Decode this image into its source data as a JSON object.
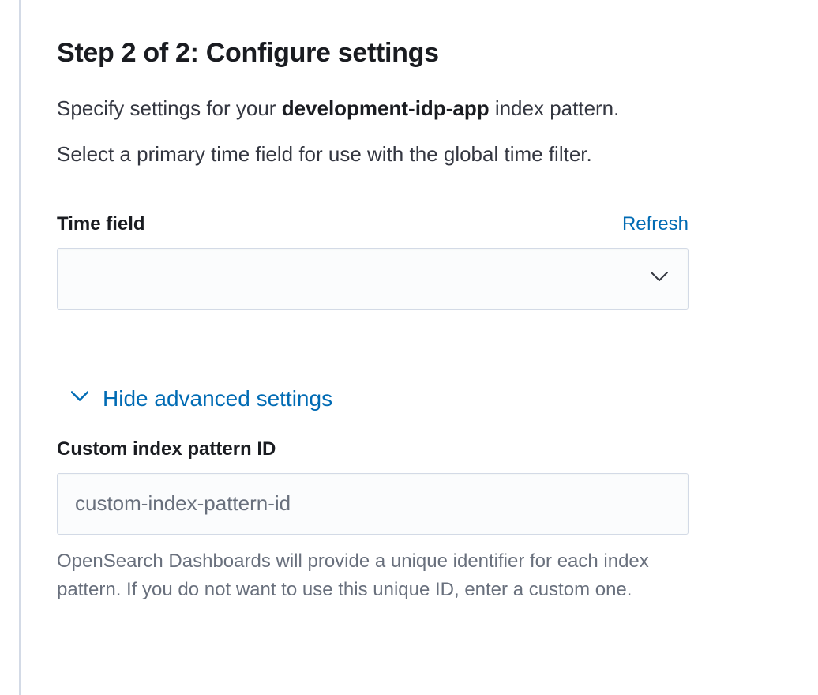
{
  "heading": "Step 2 of 2: Configure settings",
  "description_prefix": "Specify settings for your ",
  "description_pattern_name": "development-idp-app",
  "description_suffix": " index pattern.",
  "instruction": "Select a primary time field for use with the global time filter.",
  "time_field": {
    "label": "Time field",
    "refresh_label": "Refresh",
    "value": ""
  },
  "advanced": {
    "toggle_label": "Hide advanced settings",
    "custom_id_label": "Custom index pattern ID",
    "custom_id_placeholder": "custom-index-pattern-id",
    "custom_id_value": "",
    "help_text": "OpenSearch Dashboards will provide a unique identifier for each index pattern. If you do not want to use this unique ID, enter a custom one."
  },
  "colors": {
    "link": "#006bb4",
    "text": "#343741",
    "heading": "#1a1c21",
    "muted": "#69707d",
    "border": "#d3dae6"
  }
}
